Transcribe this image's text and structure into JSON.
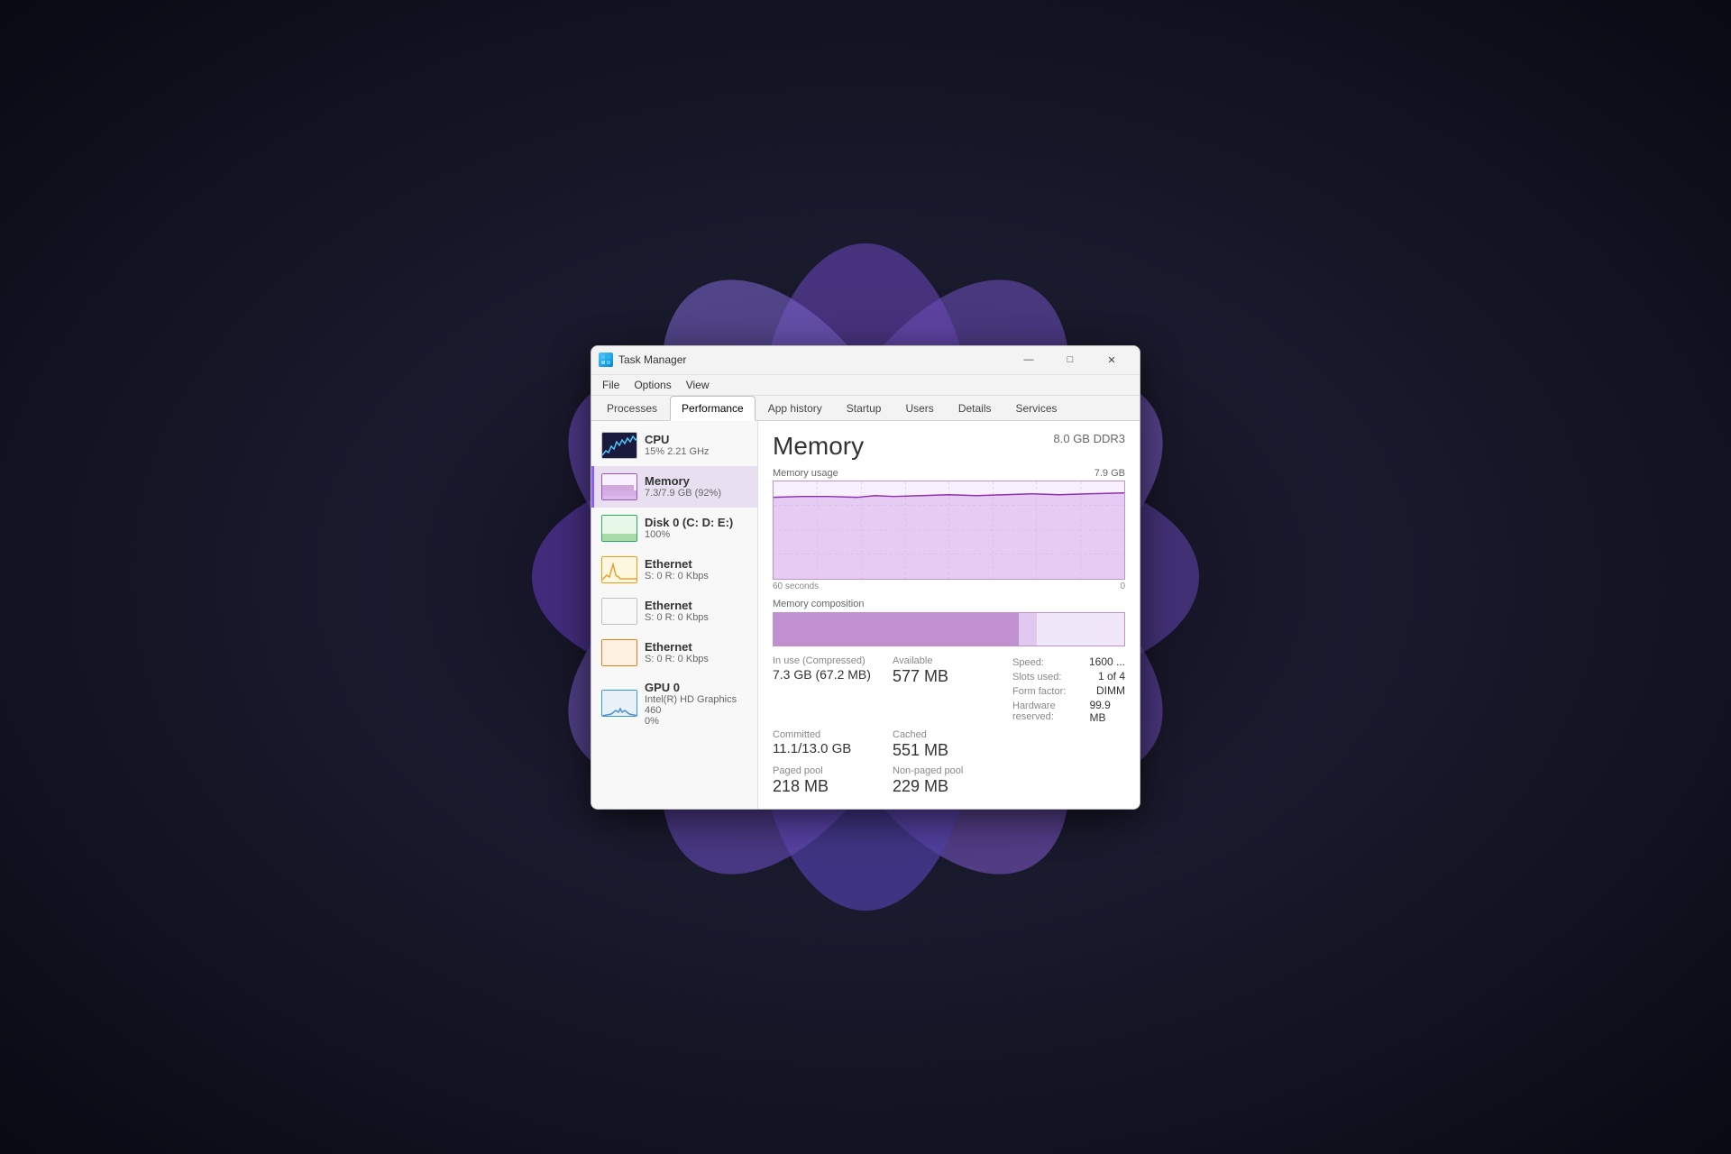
{
  "window": {
    "title": "Task Manager",
    "icon": "⚙"
  },
  "menu": {
    "items": [
      "File",
      "Options",
      "View"
    ]
  },
  "tabs": [
    {
      "label": "Processes",
      "active": false
    },
    {
      "label": "Performance",
      "active": true
    },
    {
      "label": "App history",
      "active": false
    },
    {
      "label": "Startup",
      "active": false
    },
    {
      "label": "Users",
      "active": false
    },
    {
      "label": "Details",
      "active": false
    },
    {
      "label": "Services",
      "active": false
    }
  ],
  "sidebar": {
    "items": [
      {
        "name": "CPU",
        "detail": "15% 2.21 GHz",
        "type": "cpu",
        "active": false
      },
      {
        "name": "Memory",
        "detail": "7.3/7.9 GB (92%)",
        "type": "memory",
        "active": true
      },
      {
        "name": "Disk 0 (C: D: E:)",
        "detail": "100%",
        "type": "disk",
        "active": false
      },
      {
        "name": "Ethernet",
        "detail": "S: 0 R: 0 Kbps",
        "type": "eth1",
        "active": false
      },
      {
        "name": "Ethernet",
        "detail": "S: 0 R: 0 Kbps",
        "type": "eth2",
        "active": false
      },
      {
        "name": "Ethernet",
        "detail": "S: 0 R: 0 Kbps",
        "type": "eth3",
        "active": false
      },
      {
        "name": "GPU 0",
        "detail": "Intel(R) HD Graphics 460\n0%",
        "type": "gpu",
        "active": false
      }
    ]
  },
  "detail": {
    "title": "Memory",
    "subtitle": "8.0 GB DDR3",
    "chart": {
      "label": "Memory usage",
      "max": "7.9 GB",
      "time_left": "60 seconds",
      "time_right": "0"
    },
    "composition": {
      "label": "Memory composition"
    },
    "stats": {
      "in_use_label": "In use (Compressed)",
      "in_use_value": "7.3 GB (67.2 MB)",
      "available_label": "Available",
      "available_value": "577 MB",
      "committed_label": "Committed",
      "committed_value": "11.1/13.0 GB",
      "cached_label": "Cached",
      "cached_value": "551 MB",
      "paged_label": "Paged pool",
      "paged_value": "218 MB",
      "non_paged_label": "Non-paged pool",
      "non_paged_value": "229 MB",
      "speed_label": "Speed:",
      "speed_value": "1600 ...",
      "slots_label": "Slots used:",
      "slots_value": "1 of 4",
      "form_label": "Form factor:",
      "form_value": "DIMM",
      "hw_label": "Hardware reserved:",
      "hw_value": "99.9 MB"
    }
  },
  "titlebar": {
    "minimize": "—",
    "maximize": "□",
    "close": "✕"
  }
}
